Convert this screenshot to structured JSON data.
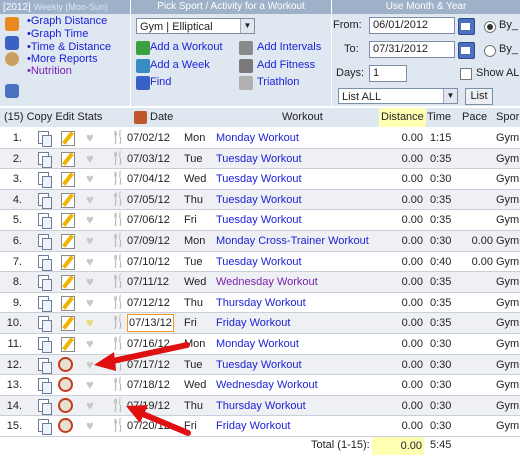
{
  "reports": {
    "year": "[2012]",
    "period": "Weekly (Mon-Sun)",
    "links": [
      "•Graph Distance",
      "•Graph Time",
      "•Time & Distance",
      "•More Reports",
      "•Nutrition"
    ]
  },
  "sport": {
    "header": "Pick Sport / Activity for a Workout",
    "selected": "Gym | Elliptical",
    "actions": {
      "add_workout": "Add a Workout",
      "add_intervals": "Add Intervals",
      "add_week": "Add a Week",
      "add_fitness": "Add Fitness",
      "find": "Find",
      "triathlon": "Triathlon"
    }
  },
  "range": {
    "header": "Use Month & Year",
    "from_label": "From:",
    "from_value": "06/01/2012",
    "to_label": "To:",
    "to_value": "07/31/2012",
    "days_label": "Days:",
    "days_value": "1",
    "radio1": "By_",
    "radio2": "By_",
    "show_all": "Show AL",
    "list_select": "List ALL",
    "list_button": "List"
  },
  "table": {
    "headers": {
      "count_tools": "(15) Copy Edit Stats",
      "date": "Date",
      "workout": "Workout",
      "distance": "Distance",
      "time": "Time",
      "pace": "Pace",
      "sport": "Spor"
    },
    "rows": [
      {
        "n": "1.",
        "date": "07/02/12",
        "day": "Mon",
        "workout": "Monday Workout",
        "dist": "0.00",
        "time": "1:15",
        "pace": "",
        "sport": "Gym"
      },
      {
        "n": "2.",
        "date": "07/03/12",
        "day": "Tue",
        "workout": "Tuesday Workout",
        "dist": "0.00",
        "time": "0:35",
        "pace": "",
        "sport": "Gym"
      },
      {
        "n": "3.",
        "date": "07/04/12",
        "day": "Wed",
        "workout": "Tuesday Workout",
        "dist": "0.00",
        "time": "0:30",
        "pace": "",
        "sport": "Gym"
      },
      {
        "n": "4.",
        "date": "07/05/12",
        "day": "Thu",
        "workout": "Tuesday Workout",
        "dist": "0.00",
        "time": "0:35",
        "pace": "",
        "sport": "Gym"
      },
      {
        "n": "5.",
        "date": "07/06/12",
        "day": "Fri",
        "workout": "Tuesday Workout",
        "dist": "0.00",
        "time": "0:35",
        "pace": "",
        "sport": "Gym"
      },
      {
        "n": "6.",
        "date": "07/09/12",
        "day": "Mon",
        "workout": "Monday Cross-Trainer Workout",
        "dist": "0.00",
        "time": "0:30",
        "pace": "0.00",
        "sport": "Gym"
      },
      {
        "n": "7.",
        "date": "07/10/12",
        "day": "Tue",
        "workout": "Tuesday Workout",
        "dist": "0.00",
        "time": "0:40",
        "pace": "0.00",
        "sport": "Gym"
      },
      {
        "n": "8.",
        "date": "07/11/12",
        "day": "Wed",
        "workout": "Wednesday Workout",
        "dist": "0.00",
        "time": "0:35",
        "pace": "",
        "sport": "Gym"
      },
      {
        "n": "9.",
        "date": "07/12/12",
        "day": "Thu",
        "workout": "Thursday Workout",
        "dist": "0.00",
        "time": "0:35",
        "pace": "",
        "sport": "Gym"
      },
      {
        "n": "10.",
        "date": "07/13/12",
        "day": "Fri",
        "workout": "Friday Workout",
        "dist": "0.00",
        "time": "0:35",
        "pace": "",
        "sport": "Gym"
      },
      {
        "n": "11.",
        "date": "07/16/12",
        "day": "Mon",
        "workout": "Monday Workout",
        "dist": "0.00",
        "time": "0:30",
        "pace": "",
        "sport": "Gym"
      },
      {
        "n": "12.",
        "date": "07/17/12",
        "day": "Tue",
        "workout": "Tuesday Workout",
        "dist": "0.00",
        "time": "0:30",
        "pace": "",
        "sport": "Gym"
      },
      {
        "n": "13.",
        "date": "07/18/12",
        "day": "Wed",
        "workout": "Wednesday Workout",
        "dist": "0.00",
        "time": "0:30",
        "pace": "",
        "sport": "Gym"
      },
      {
        "n": "14.",
        "date": "07/19/12",
        "day": "Thu",
        "workout": "Thursday Workout",
        "dist": "0.00",
        "time": "0:30",
        "pace": "",
        "sport": "Gym"
      },
      {
        "n": "15.",
        "date": "07/20/12",
        "day": "Fri",
        "workout": "Friday Workout",
        "dist": "0.00",
        "time": "0:30",
        "pace": "",
        "sport": "Gym"
      }
    ],
    "total_label": "Total (1-15):",
    "total_distance": "0.00",
    "total_time": "5:45"
  },
  "colors": {
    "header_bar": "#9fb1c9",
    "panel_bg": "#dfe7f1",
    "link": "#1a1fd6",
    "visited": "#7a1fb0",
    "annotation_arrow": "#e01010"
  }
}
